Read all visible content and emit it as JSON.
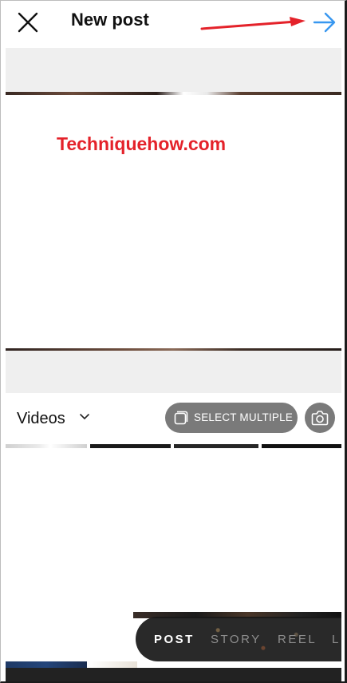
{
  "header": {
    "title": "New post",
    "close_icon": "close-icon",
    "next_icon": "arrow-right-icon",
    "next_color": "#3897f0",
    "annotation_arrow_color": "#e4222a"
  },
  "preview": {
    "watermark": "Techniquehow.com",
    "watermark_color": "#e4222a"
  },
  "gallery": {
    "album_label": "Videos",
    "album_icon": "chevron-down-icon",
    "select_multiple_label": "SELECT MULTIPLE",
    "select_multiple_icon": "stacked-squares-icon",
    "camera_icon": "camera-icon"
  },
  "modes": {
    "items": [
      "POST",
      "STORY",
      "REEL",
      "L"
    ],
    "active": "POST"
  }
}
